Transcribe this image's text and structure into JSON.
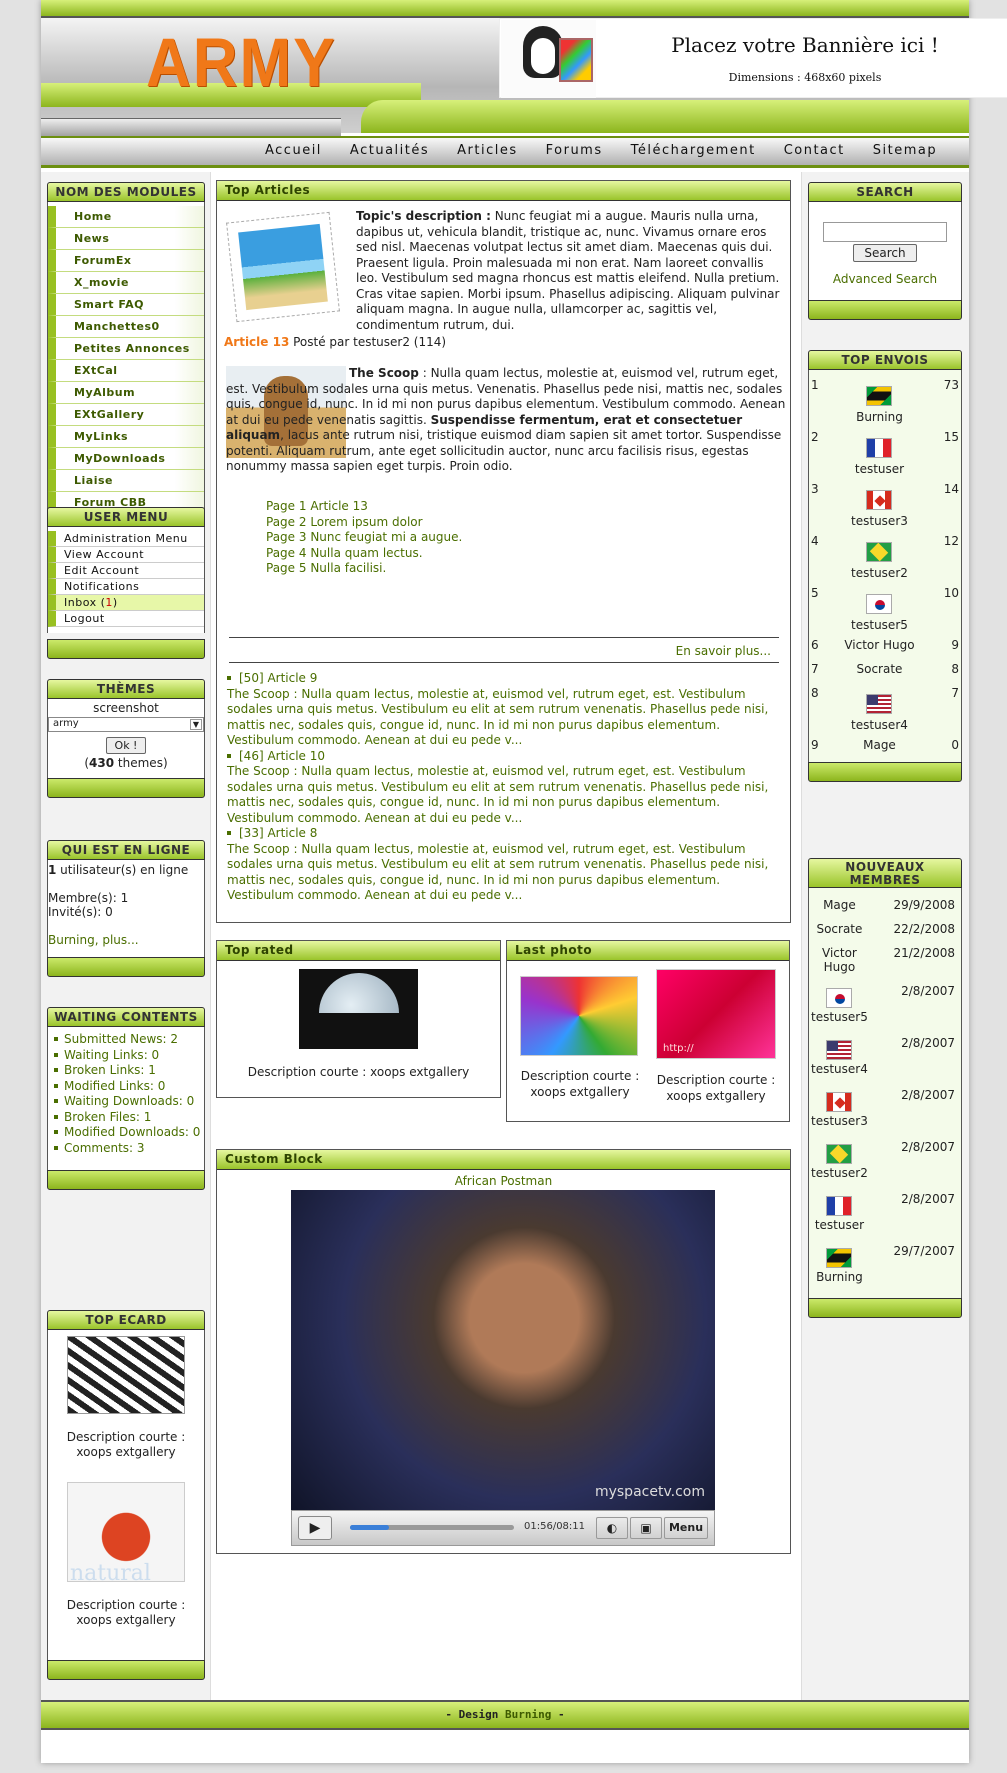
{
  "header": {
    "logo": "ARMY",
    "banner_title": "Placez votre Bannière ici !",
    "banner_sub": "Dimensions : 468x60 pixels"
  },
  "nav": [
    "Accueil",
    "Actualités",
    "Articles",
    "Forums",
    "Téléchargement",
    "Contact",
    "Sitemap"
  ],
  "modules": {
    "title": "NOM DES MODULES",
    "items": [
      "Home",
      "News",
      "ForumEx",
      "X_movie",
      "Smart FAQ",
      "Manchettes0",
      "Petites Annonces",
      "EXtCal",
      "MyAlbum",
      "EXtGallery",
      "MyLinks",
      "MyDownloads",
      "Liaise",
      "Forum CBB"
    ]
  },
  "usermenu": {
    "title": "USER MENU",
    "items": [
      "Administration Menu",
      "View Account",
      "Edit Account",
      "Notifications"
    ],
    "inbox_label": "Inbox (",
    "inbox_count": "1",
    "inbox_close": ")",
    "logout": "Logout"
  },
  "themes": {
    "title": "THÈMES",
    "screenshot": "screenshot",
    "selected": "army",
    "ok": "Ok !",
    "count_open": "(",
    "count": "430",
    "count_close": " themes)"
  },
  "online": {
    "title": "QUI EST EN LIGNE",
    "users_num": "1",
    "users_text": " utilisateur(s) en ligne",
    "members": "Membre(s): 1",
    "guests": "Invité(s): 0",
    "names": "Burning, plus..."
  },
  "waiting": {
    "title": "WAITING CONTENTS",
    "items": [
      "Submitted News: 2",
      "Waiting Links: 0",
      "Broken Links: 1",
      "Modified Links: 0",
      "Waiting Downloads: 0",
      "Broken Files: 1",
      "Modified Downloads: 0",
      "Comments: 3"
    ]
  },
  "ecard": {
    "title": "TOP ECARD",
    "desc1": "Description courte : xoops extgallery",
    "desc2": "Description courte : xoops extgallery",
    "natural": "natural"
  },
  "top_articles": {
    "title": "Top Articles",
    "topic_label": "Topic's description :",
    "topic_text": " Nunc feugiat mi a augue. Mauris nulla urna, dapibus ut, vehicula blandit, tristique ac, nunc. Vivamus ornare eros sed nisl. Maecenas volutpat lectus sit amet diam. Maecenas quis dui. Praesent ligula. Proin malesuada mi non erat. Nam laoreet convallis leo. Vestibulum sed magna rhoncus est mattis eleifend. Nulla pretium. Cras vitae sapien. Morbi ipsum. Phasellus adipiscing. Aliquam pulvinar aliquam magna. In augue nulla, ullamcorper ac, sagittis vel, condimentum rutrum, dui.",
    "article_label": "Article 13",
    "article_meta": " Posté par testuser2 (114)",
    "scoop_label": "The Scoop",
    "scoop_text1": " : Nulla quam lectus, molestie at, euismod vel, rutrum eget, est. Vestibulum sodales urna quis metus. Venenatis. Phasellus pede nisi, mattis nec, sodales quis, congue id, nunc. In id mi non purus dapibus elementum. Vestibulum commodo. Aenean at dui eu pede venenatis sagittis. ",
    "scoop_bold": "Suspendisse fermentum, erat et consectetuer aliquam",
    "scoop_text2": ", lacus ante rutrum nisi, tristique euismod diam sapien sit amet tortor. Suspendisse potenti. Aliquam rutrum, ante eget sollicitudin auctor, nunc arcu facilisis risus, egestas nonummy massa sapien eget turpis. Proin odio.",
    "pages": [
      "Page 1 Article 13",
      "Page 2 Lorem ipsum dolor",
      "Page 3 Nunc feugiat mi a augue.",
      "Page 4 Nulla quam lectus.",
      "Page 5 Nulla facilisi."
    ],
    "more": "En savoir plus...",
    "list": [
      {
        "head": "[50] Article 9",
        "text": "The Scoop : Nulla quam lectus, molestie at, euismod vel, rutrum eget, est. Vestibulum sodales urna quis metus. Vestibulum eu elit at sem rutrum venenatis. Phasellus pede nisi, mattis nec, sodales quis, congue id, nunc. In id mi non purus dapibus elementum. Vestibulum commodo. Aenean at dui eu pede v..."
      },
      {
        "head": "[46] Article 10",
        "text": "The Scoop : Nulla quam lectus, molestie at, euismod vel, rutrum eget, est. Vestibulum sodales urna quis metus. Vestibulum eu elit at sem rutrum venenatis. Phasellus pede nisi, mattis nec, sodales quis, congue id, nunc. In id mi non purus dapibus elementum. Vestibulum commodo. Aenean at dui eu pede v..."
      },
      {
        "head": "[33] Article 8",
        "text": "The Scoop : Nulla quam lectus, molestie at, euismod vel, rutrum eget, est. Vestibulum sodales urna quis metus. Vestibulum eu elit at sem rutrum venenatis. Phasellus pede nisi, mattis nec, sodales quis, congue id, nunc. In id mi non purus dapibus elementum. Vestibulum commodo. Aenean at dui eu pede v..."
      }
    ]
  },
  "top_rated": {
    "title": "Top rated",
    "desc": "Description courte : xoops extgallery"
  },
  "last_photo": {
    "title": "Last photo",
    "desc1": "Description courte : xoops extgallery",
    "desc2": "Description courte : xoops extgallery",
    "watermark": "http://"
  },
  "custom": {
    "title": "Custom Block",
    "caption": "African Postman",
    "brand": "myspacetv.com",
    "time": "01:56/08:11",
    "menu": "Menu",
    "progress": 0.24
  },
  "search": {
    "title": "SEARCH",
    "button": "Search",
    "advanced": "Advanced Search",
    "value": ""
  },
  "top_envois": {
    "title": "TOP ENVOIS",
    "rows": [
      {
        "rank": "1",
        "name": "Burning",
        "count": "73",
        "flag": "jamaica-flag"
      },
      {
        "rank": "2",
        "name": "testuser",
        "count": "15",
        "flag": "france-flag"
      },
      {
        "rank": "3",
        "name": "testuser3",
        "count": "14",
        "flag": "canada-flag"
      },
      {
        "rank": "4",
        "name": "testuser2",
        "count": "12",
        "flag": "brazil-flag"
      },
      {
        "rank": "5",
        "name": "testuser5",
        "count": "10",
        "flag": "korea-flag"
      },
      {
        "rank": "6",
        "name": "Victor Hugo",
        "count": "9",
        "flag": ""
      },
      {
        "rank": "7",
        "name": "Socrate",
        "count": "8",
        "flag": ""
      },
      {
        "rank": "8",
        "name": "testuser4",
        "count": "7",
        "flag": "usa-flag"
      },
      {
        "rank": "9",
        "name": "Mage",
        "count": "0",
        "flag": ""
      }
    ]
  },
  "nouveaux": {
    "title": "NOUVEAUX MEMBRES",
    "rows": [
      {
        "name": "Mage",
        "date": "29/9/2008",
        "flag": ""
      },
      {
        "name": "Socrate",
        "date": "22/2/2008",
        "flag": ""
      },
      {
        "name": "Victor Hugo",
        "date": "21/2/2008",
        "flag": ""
      },
      {
        "name": "testuser5",
        "date": "2/8/2007",
        "flag": "korea-flag"
      },
      {
        "name": "testuser4",
        "date": "2/8/2007",
        "flag": "usa-flag"
      },
      {
        "name": "testuser3",
        "date": "2/8/2007",
        "flag": "canada-flag"
      },
      {
        "name": "testuser2",
        "date": "2/8/2007",
        "flag": "brazil-flag"
      },
      {
        "name": "testuser",
        "date": "2/8/2007",
        "flag": "france-flag"
      },
      {
        "name": "Burning",
        "date": "29/7/2007",
        "flag": "jamaica-flag"
      }
    ]
  },
  "footer": {
    "prefix": "- Design ",
    "author": "Burning",
    "suffix": " -"
  },
  "colors": {
    "accent": "#98c021",
    "link": "#4a6e00",
    "orange": "#f07818"
  }
}
